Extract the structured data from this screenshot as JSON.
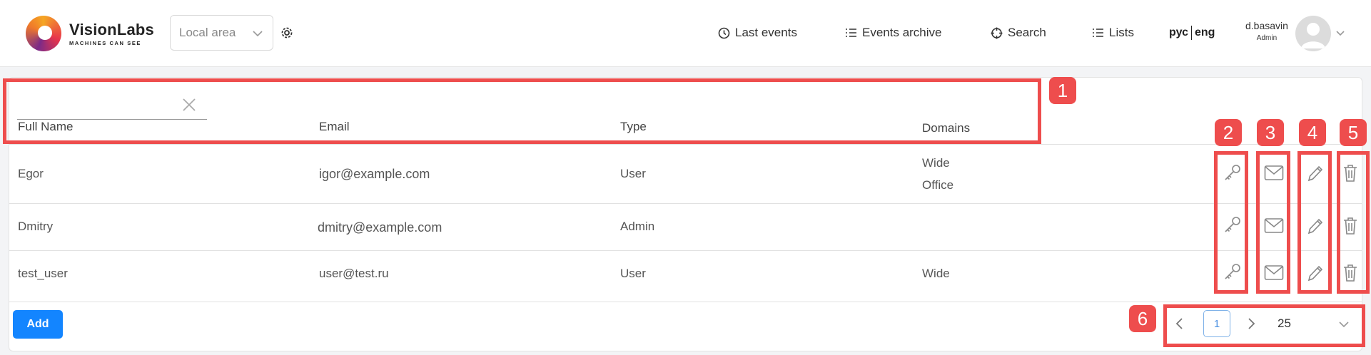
{
  "header": {
    "logo_title": "VisionLabs",
    "logo_subtitle": "MACHINES CAN SEE",
    "area_select_value": "Local area",
    "nav": [
      {
        "label": "Last events",
        "icon": "clock-icon"
      },
      {
        "label": "Events archive",
        "icon": "list-icon"
      },
      {
        "label": "Search",
        "icon": "crosshair-icon"
      },
      {
        "label": "Lists",
        "icon": "list-icon"
      }
    ],
    "lang_ru": "рус",
    "lang_en": "eng",
    "user_name": "d.basavin",
    "user_role": "Admin"
  },
  "table": {
    "filter_value": "",
    "columns": [
      "Full Name",
      "Email",
      "Type",
      "Domains"
    ],
    "rows": [
      {
        "name": "Egor",
        "email": "igor@example.com",
        "type": "User",
        "domains": [
          "Wide",
          "Office"
        ]
      },
      {
        "name": "Dmitry",
        "email": "dmitry@example.com",
        "type": "Admin",
        "domains": []
      },
      {
        "name": "test_user",
        "email": "user@test.ru",
        "type": "User",
        "domains": [
          "Wide"
        ]
      }
    ],
    "row_actions": [
      "key-icon",
      "mail-icon",
      "pencil-icon",
      "trash-icon"
    ]
  },
  "footer": {
    "add_label": "Add",
    "current_page": "1",
    "page_size": "25"
  },
  "callouts": [
    "1",
    "2",
    "3",
    "4",
    "5",
    "6"
  ],
  "colors": {
    "accent": "#1385ff",
    "callout": "#ee4d4d"
  }
}
